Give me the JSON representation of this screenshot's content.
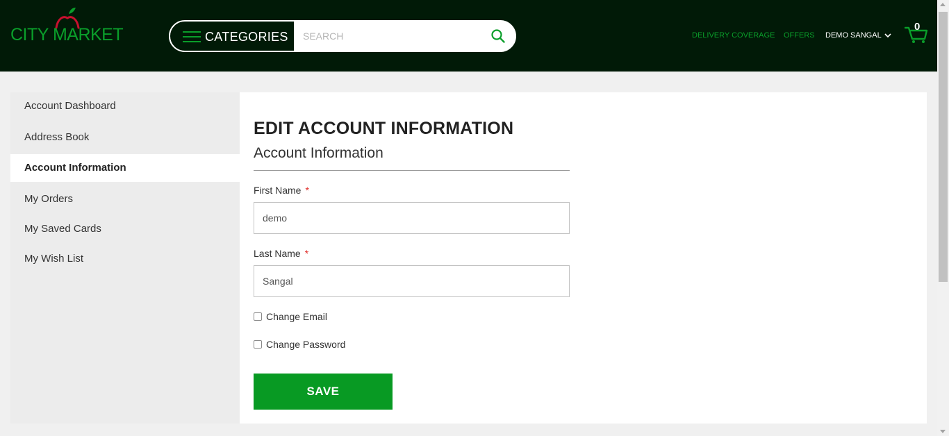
{
  "header": {
    "logo_text": "CITY MARKET",
    "categories_label": "CATEGORIES",
    "search_placeholder": "SEARCH",
    "links": {
      "delivery": "DELIVERY COVERAGE",
      "offers": "OFFERS"
    },
    "user_name": "DEMO SANGAL",
    "cart_count": "0"
  },
  "sidebar": {
    "items": [
      {
        "label": "Account Dashboard"
      },
      {
        "label": "Address Book"
      },
      {
        "label": "Account Information"
      },
      {
        "label": "My Orders"
      },
      {
        "label": "My Saved Cards"
      },
      {
        "label": "My Wish List"
      }
    ],
    "active_label": "Account Information"
  },
  "main": {
    "page_title": "EDIT ACCOUNT INFORMATION",
    "section_title": "Account Information",
    "first_name_label": "First Name",
    "first_name_value": "demo",
    "last_name_label": "Last Name",
    "last_name_value": "Sangal",
    "required_mark": "*",
    "change_email_label": "Change Email",
    "change_password_label": "Change Password",
    "save_label": "SAVE"
  },
  "colors": {
    "header_bg": "#011a07",
    "brand_green": "#0a9e2a",
    "save_button": "#089a23",
    "required": "#e02b27"
  },
  "icons": [
    "apple-logo-icon",
    "hamburger-icon",
    "search-icon",
    "chevron-down-icon",
    "cart-icon"
  ]
}
